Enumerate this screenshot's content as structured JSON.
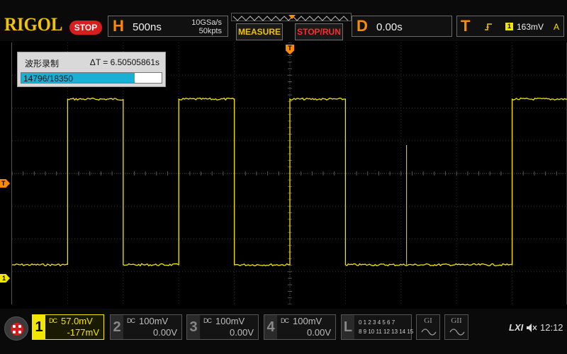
{
  "header": {
    "brand": "RIGOL",
    "run_state": "STOP",
    "timebase": {
      "letter": "H",
      "value": "500ns",
      "sample_rate": "10GSa/s",
      "memory_depth": "50kpts"
    },
    "buttons": {
      "measure": "MEASURE",
      "stop_run": "STOP/RUN"
    },
    "delay": {
      "letter": "D",
      "value": "0.00s"
    },
    "trigger": {
      "letter": "T",
      "level": "163mV",
      "source_channel": "1",
      "mode": "A"
    }
  },
  "recording": {
    "title": "波形录制",
    "delta_t": "ΔT = 6.50505861s",
    "frame_count": "14796/18350",
    "progress_fraction": 0.806
  },
  "markers": {
    "trigger_top": "T",
    "trigger_left": "T",
    "ch1_left": "1"
  },
  "channels": [
    {
      "num": "1",
      "scale": "57.0mV",
      "offset": "-177mV",
      "coupling": "DC",
      "active": true,
      "color": "#f2e600"
    },
    {
      "num": "2",
      "scale": "100mV",
      "offset": "0.00V",
      "coupling": "DC",
      "active": false
    },
    {
      "num": "3",
      "scale": "100mV",
      "offset": "0.00V",
      "coupling": "DC",
      "active": false
    },
    {
      "num": "4",
      "scale": "100mV",
      "offset": "0.00V",
      "coupling": "DC",
      "active": false
    }
  ],
  "logic": {
    "label": "L",
    "row1": "0 1 2 3  4 5 6 7",
    "row2": "8 9 10 11 12 13 14 15"
  },
  "generators": [
    {
      "label": "GI"
    },
    {
      "label": "GII"
    }
  ],
  "status": {
    "lxi": "LXI",
    "time": "12:12"
  },
  "icons": {
    "menu": "menu-grid-icon",
    "trigger_edge": "rising-edge-icon",
    "speaker": "speaker-muted-icon",
    "sine": "sine-wave-icon"
  },
  "colors": {
    "trace": "#f2e600",
    "accent_orange": "#ff8a00",
    "stop_red": "#d81d1d",
    "progress": "#1ab0d6"
  },
  "chart_data": {
    "type": "line",
    "series": [
      {
        "values": [
          {
            "x": 0,
            "y": 0
          },
          {
            "x": 1.0,
            "y": 0
          },
          {
            "x": 1.0,
            "y": 1
          },
          {
            "x": 2.0,
            "y": 1
          },
          {
            "x": 2.0,
            "y": 0
          },
          {
            "x": 3.0,
            "y": 0
          },
          {
            "x": 3.0,
            "y": 1
          },
          {
            "x": 4.0,
            "y": 1
          },
          {
            "x": 4.0,
            "y": 0
          },
          {
            "x": 5.0,
            "y": 0
          },
          {
            "x": 5.0,
            "y": 1
          },
          {
            "x": 6.0,
            "y": 1
          },
          {
            "x": 6.0,
            "y": 0
          },
          {
            "x": 9.0,
            "y": 0
          },
          {
            "x": 9.0,
            "y": 1
          },
          {
            "x": 10.0,
            "y": 1
          }
        ]
      }
    ]
  }
}
